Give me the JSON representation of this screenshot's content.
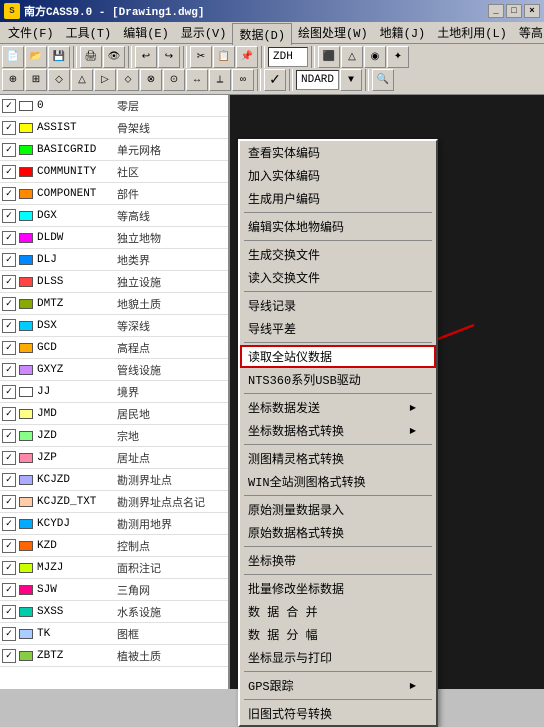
{
  "title": {
    "app_name": "南方CASS9.0 - [Drawing1.dwg]",
    "icon_char": "S"
  },
  "title_controls": {
    "minimize": "_",
    "maximize": "□",
    "close": "×"
  },
  "menu_bar": {
    "items": [
      {
        "label": "文件(F)",
        "active": false
      },
      {
        "label": "工具(T)",
        "active": false
      },
      {
        "label": "编辑(E)",
        "active": false
      },
      {
        "label": "显示(V)",
        "active": false
      },
      {
        "label": "数据(D)",
        "active": true
      },
      {
        "label": "绘图处理(W)",
        "active": false
      },
      {
        "label": "地籍(J)",
        "active": false
      },
      {
        "label": "土地利用(L)",
        "active": false
      },
      {
        "label": "等高",
        "active": false
      }
    ]
  },
  "toolbar": {
    "label_text": "ZDH",
    "label_extra": "NDARD"
  },
  "data_menu": {
    "items": [
      {
        "label": "查看实体编码",
        "submenu": false,
        "separator_after": false
      },
      {
        "label": "加入实体编码",
        "submenu": false,
        "separator_after": false
      },
      {
        "label": "生成用户编码",
        "submenu": false,
        "separator_after": true
      },
      {
        "label": "编辑实体地物编码",
        "submenu": false,
        "separator_after": true
      },
      {
        "label": "生成交换文件",
        "submenu": false,
        "separator_after": false
      },
      {
        "label": "读入交换文件",
        "submenu": false,
        "separator_after": true
      },
      {
        "label": "导线记录",
        "submenu": false,
        "separator_after": false
      },
      {
        "label": "导线平差",
        "submenu": false,
        "separator_after": true
      },
      {
        "label": "读取全站仪数据",
        "submenu": false,
        "separator_after": false,
        "active": true
      },
      {
        "label": "NTS360系列USB驱动",
        "submenu": false,
        "separator_after": true
      },
      {
        "label": "坐标数据发送",
        "submenu": true,
        "separator_after": false
      },
      {
        "label": "坐标数据格式转换",
        "submenu": true,
        "separator_after": true
      },
      {
        "label": "测图精灵格式转换",
        "submenu": false,
        "separator_after": false
      },
      {
        "label": "WIN全站测图格式转换",
        "submenu": false,
        "separator_after": true
      },
      {
        "label": "原始测量数据录入",
        "submenu": false,
        "separator_after": false
      },
      {
        "label": "原始数据格式转换",
        "submenu": false,
        "separator_after": true
      },
      {
        "label": "坐标换带",
        "submenu": false,
        "separator_after": true
      },
      {
        "label": "批量修改坐标数据",
        "submenu": false,
        "separator_after": false
      },
      {
        "label": "数 据 合 并",
        "submenu": false,
        "separator_after": false
      },
      {
        "label": "数 据 分 幅",
        "submenu": false,
        "separator_after": false
      },
      {
        "label": "坐标显示与打印",
        "submenu": false,
        "separator_after": true
      },
      {
        "label": "GPS跟踪",
        "submenu": true,
        "separator_after": true
      },
      {
        "label": "旧图式符号转换",
        "submenu": false,
        "separator_after": false
      }
    ]
  },
  "layers": [
    {
      "checked": true,
      "color": "#ffffff",
      "name": "0",
      "desc": "零层"
    },
    {
      "checked": true,
      "color": "#ffff00",
      "name": "ASSIST",
      "desc": "骨架线"
    },
    {
      "checked": true,
      "color": "#00ff00",
      "name": "BASICGRID",
      "desc": "单元网格"
    },
    {
      "checked": true,
      "color": "#ff0000",
      "name": "COMMUNITY",
      "desc": "社区"
    },
    {
      "checked": true,
      "color": "#ff8800",
      "name": "COMPONENT",
      "desc": "部件"
    },
    {
      "checked": true,
      "color": "#00ffff",
      "name": "DGX",
      "desc": "等高线"
    },
    {
      "checked": true,
      "color": "#ff00ff",
      "name": "DLDW",
      "desc": "独立地物"
    },
    {
      "checked": true,
      "color": "#0088ff",
      "name": "DLJ",
      "desc": "地类界"
    },
    {
      "checked": true,
      "color": "#ff4444",
      "name": "DLSS",
      "desc": "独立设施"
    },
    {
      "checked": true,
      "color": "#88aa00",
      "name": "DMTZ",
      "desc": "地貌土质"
    },
    {
      "checked": true,
      "color": "#00ccff",
      "name": "DSX",
      "desc": "等深线"
    },
    {
      "checked": true,
      "color": "#ffaa00",
      "name": "GCD",
      "desc": "高程点"
    },
    {
      "checked": true,
      "color": "#cc88ff",
      "name": "GXYZ",
      "desc": "管线设施"
    },
    {
      "checked": true,
      "color": "#ffffff",
      "name": "JJ",
      "desc": "境界"
    },
    {
      "checked": true,
      "color": "#ffff88",
      "name": "JMD",
      "desc": "居民地"
    },
    {
      "checked": true,
      "color": "#88ff88",
      "name": "JZD",
      "desc": "宗地"
    },
    {
      "checked": true,
      "color": "#ff88aa",
      "name": "JZP",
      "desc": "居址点"
    },
    {
      "checked": true,
      "color": "#aaaaff",
      "name": "KCJZD",
      "desc": "勘测界址点"
    },
    {
      "checked": true,
      "color": "#ffccaa",
      "name": "KCJZD_TXT",
      "desc": "勘测界址点点名记"
    },
    {
      "checked": true,
      "color": "#00aaff",
      "name": "KCYDJ",
      "desc": "勘测用地界"
    },
    {
      "checked": true,
      "color": "#ff6600",
      "name": "KZD",
      "desc": "控制点"
    },
    {
      "checked": true,
      "color": "#ccff00",
      "name": "MJZJ",
      "desc": "面积注记"
    },
    {
      "checked": true,
      "color": "#ff0088",
      "name": "SJW",
      "desc": "三角网"
    },
    {
      "checked": true,
      "color": "#00ccaa",
      "name": "SXSS",
      "desc": "水系设施"
    },
    {
      "checked": true,
      "color": "#aaccff",
      "name": "TK",
      "desc": "图框"
    },
    {
      "checked": true,
      "color": "#88cc44",
      "name": "ZBTZ",
      "desc": "植被土质"
    }
  ]
}
